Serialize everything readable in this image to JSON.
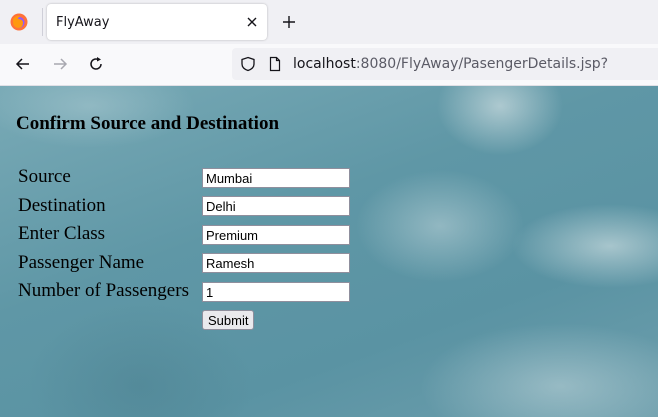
{
  "browser": {
    "tab_title": "FlyAway",
    "url_host": "localhost",
    "url_rest": ":8080/FlyAway/PasengerDetails.jsp?"
  },
  "page": {
    "heading": "Confirm Source and Destination",
    "form": {
      "fields": [
        {
          "label": "Source",
          "value": "Mumbai"
        },
        {
          "label": "Destination",
          "value": "Delhi"
        },
        {
          "label": "Enter Class",
          "value": "Premium"
        },
        {
          "label": "Passenger Name",
          "value": "Ramesh"
        },
        {
          "label": "Number of Passengers",
          "value": "1"
        }
      ],
      "submit_label": "Submit"
    }
  }
}
